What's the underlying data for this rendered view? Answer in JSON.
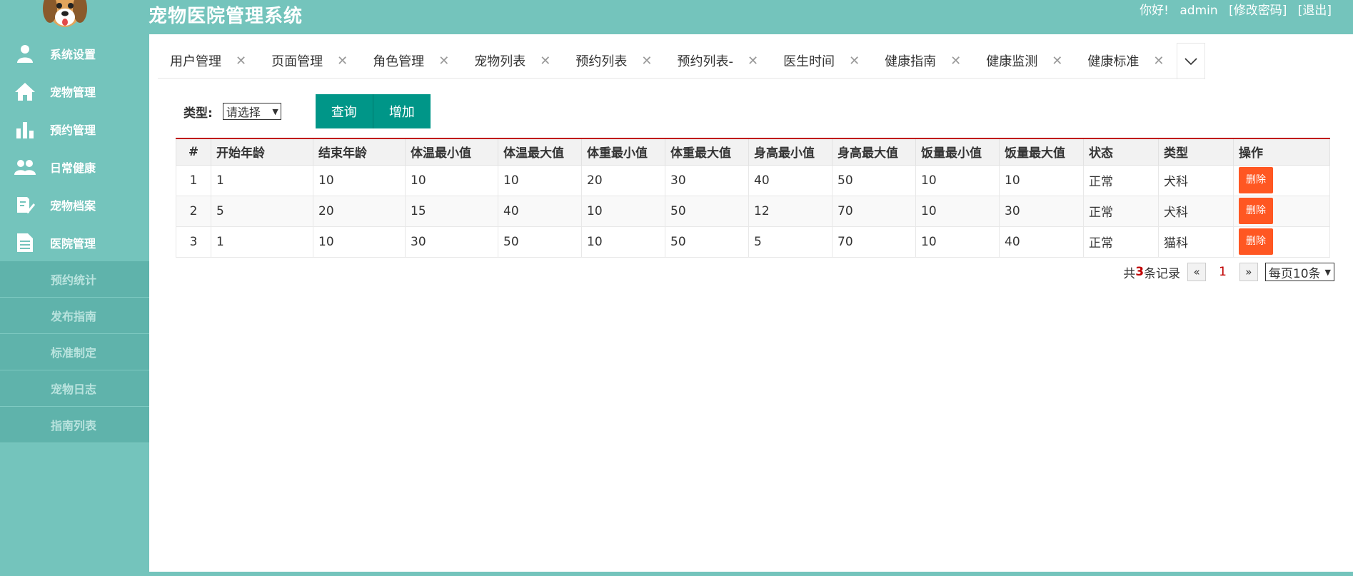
{
  "header": {
    "title": "宠物医院管理系统",
    "greeting": "你好!",
    "username": "admin",
    "change_password": "[修改密码]",
    "logout": "[退出]"
  },
  "sidebar": {
    "items": [
      {
        "label": "系统设置",
        "icon": "user-icon"
      },
      {
        "label": "宠物管理",
        "icon": "home-icon"
      },
      {
        "label": "预约管理",
        "icon": "bar-chart-icon"
      },
      {
        "label": "日常健康",
        "icon": "group-icon"
      },
      {
        "label": "宠物档案",
        "icon": "edit-check-icon"
      },
      {
        "label": "医院管理",
        "icon": "document-icon"
      }
    ],
    "sub_items": [
      {
        "label": "预约统计"
      },
      {
        "label": "发布指南"
      },
      {
        "label": "标准制定"
      },
      {
        "label": "宠物日志"
      },
      {
        "label": "指南列表"
      }
    ]
  },
  "tabs": [
    {
      "label": "用户管理"
    },
    {
      "label": "页面管理"
    },
    {
      "label": "角色管理"
    },
    {
      "label": "宠物列表"
    },
    {
      "label": "预约列表"
    },
    {
      "label": "预约列表-"
    },
    {
      "label": "医生时间"
    },
    {
      "label": "健康指南"
    },
    {
      "label": "健康监测"
    },
    {
      "label": "健康标准"
    }
  ],
  "filter": {
    "label": "类型:",
    "select_value": "请选择",
    "query_button": "查询",
    "add_button": "增加"
  },
  "table": {
    "columns": [
      "#",
      "开始年龄",
      "结束年龄",
      "体温最小值",
      "体温最大值",
      "体重最小值",
      "体重最大值",
      "身高最小值",
      "身高最大值",
      "饭量最小值",
      "饭量最大值",
      "状态",
      "类型",
      "操作"
    ],
    "rows": [
      [
        "1",
        "1",
        "10",
        "10",
        "10",
        "20",
        "30",
        "40",
        "50",
        "10",
        "10",
        "正常",
        "犬科"
      ],
      [
        "2",
        "5",
        "20",
        "15",
        "40",
        "10",
        "50",
        "12",
        "70",
        "10",
        "30",
        "正常",
        "犬科"
      ],
      [
        "3",
        "1",
        "10",
        "30",
        "50",
        "10",
        "50",
        "5",
        "70",
        "10",
        "40",
        "正常",
        "猫科"
      ]
    ],
    "delete_label": "删除"
  },
  "pager": {
    "prefix": "共",
    "count": "3",
    "suffix": "条记录",
    "prev": "«",
    "page": "1",
    "next": "»",
    "page_size": "每页10条"
  },
  "colors": {
    "theme": "#74c4bc",
    "submenu": "#5fb3ab",
    "primary_button": "#009688",
    "delete_button": "#ff5722",
    "accent_red": "#c00000"
  }
}
